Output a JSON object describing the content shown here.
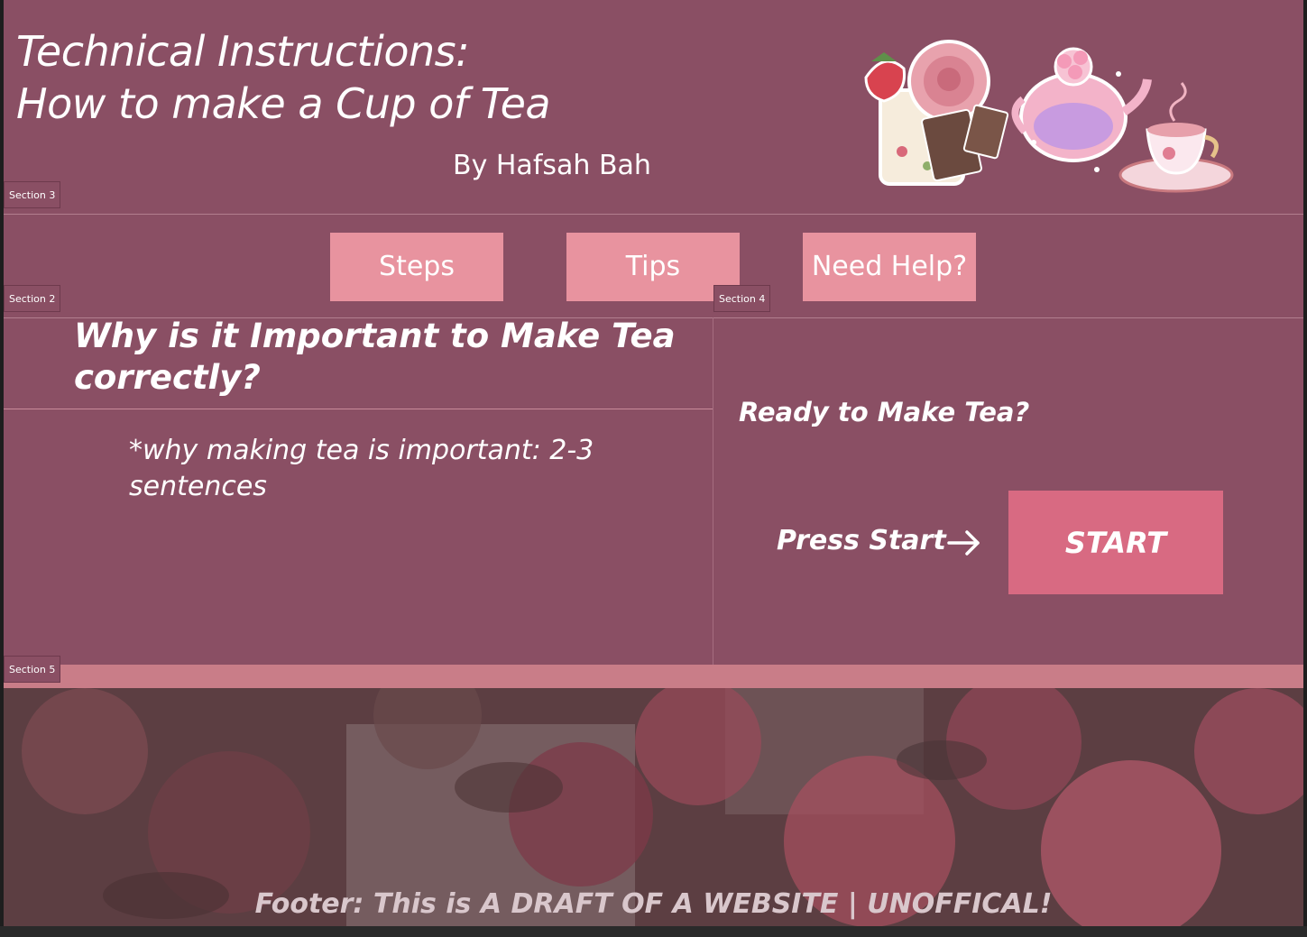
{
  "header": {
    "title_line1": "Technical Instructions:",
    "title_line2": "How to make a Cup of Tea",
    "byline": "By Hafsah Bah",
    "hero_art_icon": "tea-set-illustration-icon"
  },
  "section_tags": {
    "section3": "Section 3",
    "section2": "Section 2",
    "section4": "Section 4",
    "section5": "Section 5"
  },
  "nav": {
    "steps": "Steps",
    "tips": "Tips",
    "help": "Need Help?"
  },
  "why": {
    "heading": "Why is it Important to Make Tea correctly?",
    "body": "*why making tea is important: 2-3 sentences"
  },
  "ready": {
    "heading": "Ready to Make Tea?",
    "press_start": "Press Start",
    "arrow_icon": "arrow-right-icon",
    "start_button": "START"
  },
  "footer": {
    "text": "Footer: This is A DRAFT OF A WEBSITE | UNOFFICAL!",
    "background_icon": "floral-photo-background"
  },
  "colors": {
    "page_background": "#8a4f64",
    "nav_button": "#e8939f",
    "start_button": "#d86a82",
    "section5_band": "#c97d88",
    "text": "#ffffff",
    "footer_text": "#d9c7cc"
  }
}
